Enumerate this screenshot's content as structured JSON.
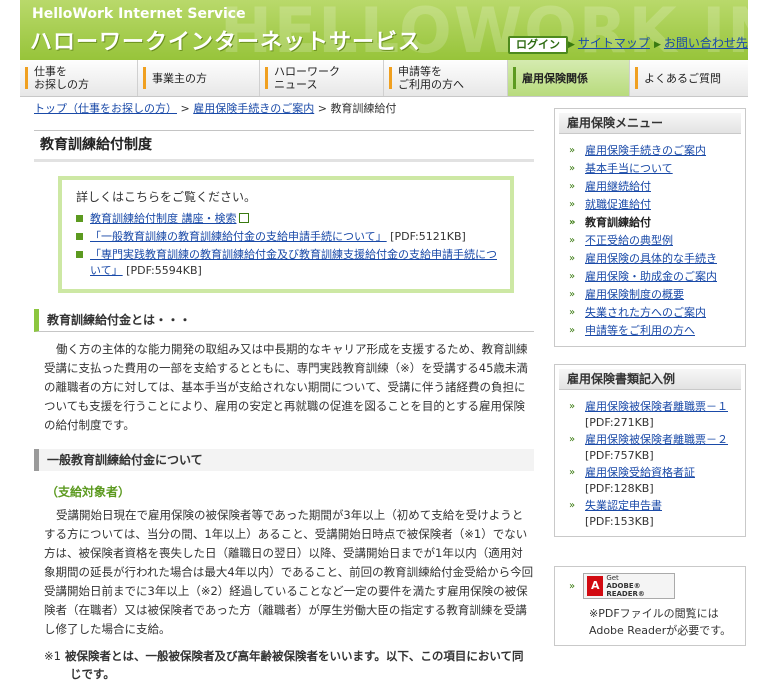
{
  "header": {
    "service_en": "HelloWork Internet Service",
    "service_ja": "ハローワークインターネットサービス",
    "watermark": "HELLOWORK INTERNET",
    "login": "ログイン",
    "sitemap": "サイトマップ",
    "contact": "お問い合わせ先"
  },
  "nav": [
    {
      "line1": "仕事を",
      "line2": "お探しの方"
    },
    {
      "line1": "事業主の方",
      "line2": ""
    },
    {
      "line1": "ハローワーク",
      "line2": "ニュース"
    },
    {
      "line1": "申請等を",
      "line2": "ご利用の方へ"
    },
    {
      "line1": "雇用保険関係",
      "line2": ""
    },
    {
      "line1": "よくあるご質問",
      "line2": ""
    }
  ],
  "breadcrumb": {
    "top": "トップ（仕事をお探しの方）",
    "sep": ">",
    "mid": "雇用保険手続きのご案内",
    "current": "教育訓練給付"
  },
  "main": {
    "title": "教育訓練給付制度",
    "info_intro": "詳しくはこちらをご覧ください。",
    "info_links": [
      {
        "text": "教育訓練給付制度 講座・検索",
        "suffix": ""
      },
      {
        "text": "「一般教育訓練の教育訓練給付金の支給申請手続について」",
        "suffix": "[PDF:5121KB]"
      },
      {
        "text": "「専門実践教育訓練の教育訓練給付金及び教育訓練支援給付金の支給申請手続について」",
        "suffix": "[PDF:5594KB]"
      }
    ],
    "h2": "教育訓練給付金とは・・・",
    "para1": "働く方の主体的な能力開発の取組み又は中長期的なキャリア形成を支援するため、教育訓練受講に支払った費用の一部を支給するとともに、専門実践教育訓練（※）を受講する45歳未満の離職者の方に対しては、基本手当が支給されない期間について、受講に伴う諸経費の負担についても支援を行うことにより、雇用の安定と再就職の促進を図ることを目的とする雇用保険の給付制度です。",
    "h3": "一般教育訓練給付金について",
    "h4": "（支給対象者）",
    "para2": "受講開始日現在で雇用保険の被保険者等であった期間が3年以上（初めて支給を受けようとする方については、当分の間、1年以上）あること、受講開始日時点で被保険者（※1）でない方は、被保険者資格を喪失した日（離職日の翌日）以降、受講開始日までが1年以内（適用対象期間の延長が行われた場合は最大4年以内）であること、前回の教育訓練給付金受給から今回受講開始日前までに3年以上（※2）経過していることなど一定の要件を満たす雇用保険の被保険者（在職者）又は被保険者であった方（離職者）が厚生労働大臣の指定する教育訓練を受講し修了した場合に支給。",
    "note_mark": "※1",
    "note": "被保険者とは、一般被保険者及び高年齢被保険者をいいます。以下、この項目において同じです。"
  },
  "sidebar": {
    "menu_title": "雇用保険メニュー",
    "menu_items": [
      {
        "text": "雇用保険手続きのご案内",
        "current": false
      },
      {
        "text": "基本手当について",
        "current": false
      },
      {
        "text": "雇用継続給付",
        "current": false
      },
      {
        "text": "就職促進給付",
        "current": false
      },
      {
        "text": "教育訓練給付",
        "current": true
      },
      {
        "text": "不正受給の典型例",
        "current": false
      },
      {
        "text": "雇用保険の具体的な手続き",
        "current": false
      },
      {
        "text": "雇用保険・助成金のご案内",
        "current": false
      },
      {
        "text": "雇用保険制度の概要",
        "current": false
      },
      {
        "text": "失業された方へのご案内",
        "current": false
      },
      {
        "text": "申請等をご利用の方へ",
        "current": false
      }
    ],
    "forms_title": "雇用保険書類記入例",
    "forms": [
      {
        "text": "雇用保険被保険者離職票－１",
        "size": "[PDF:271KB]"
      },
      {
        "text": "雇用保険被保険者離職票－２",
        "size": "[PDF:757KB]"
      },
      {
        "text": "雇用保険受給資格者証",
        "size": "[PDF:128KB]"
      },
      {
        "text": "失業認定申告書",
        "size": "[PDF:153KB]"
      }
    ],
    "adobe_get": "Get",
    "adobe_reader": "ADOBE® READER®",
    "adobe_note": "※PDFファイルの閲覧にはAdobe Readerが必要です。"
  },
  "colors": {
    "header_green": "#97c43a",
    "link": "#1a4aa8",
    "accent": "#5c9a20"
  }
}
